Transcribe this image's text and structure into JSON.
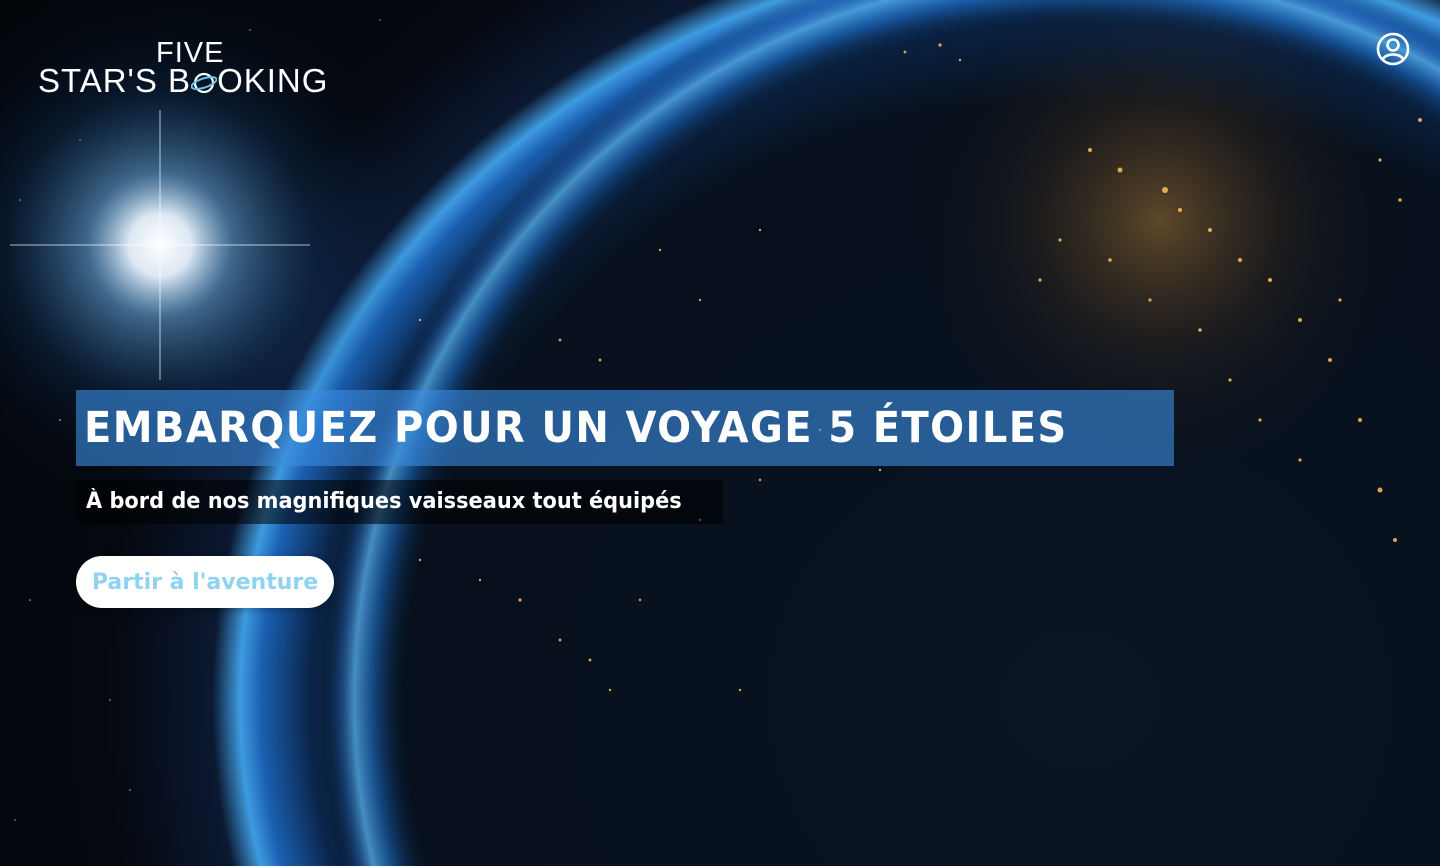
{
  "brand": {
    "logo_top": "FIVE",
    "logo_main_part1": "STAR'S B",
    "logo_main_part2": "OKING",
    "logo_color": "#ffffff",
    "logo_accent": "#63c6ea"
  },
  "header": {
    "account_icon": "user-circle-icon"
  },
  "hero": {
    "headline": "EMBARQUEZ POUR UN VOYAGE 5 ÉTOILES",
    "subtitle": "À bord de nos magnifiques vaisseaux tout équipés",
    "cta_label": "Partir à l'aventure",
    "headline_bg": "#3a8ade",
    "cta_text_color": "#8fd3f0",
    "background_image": "earth-at-night-from-space"
  }
}
